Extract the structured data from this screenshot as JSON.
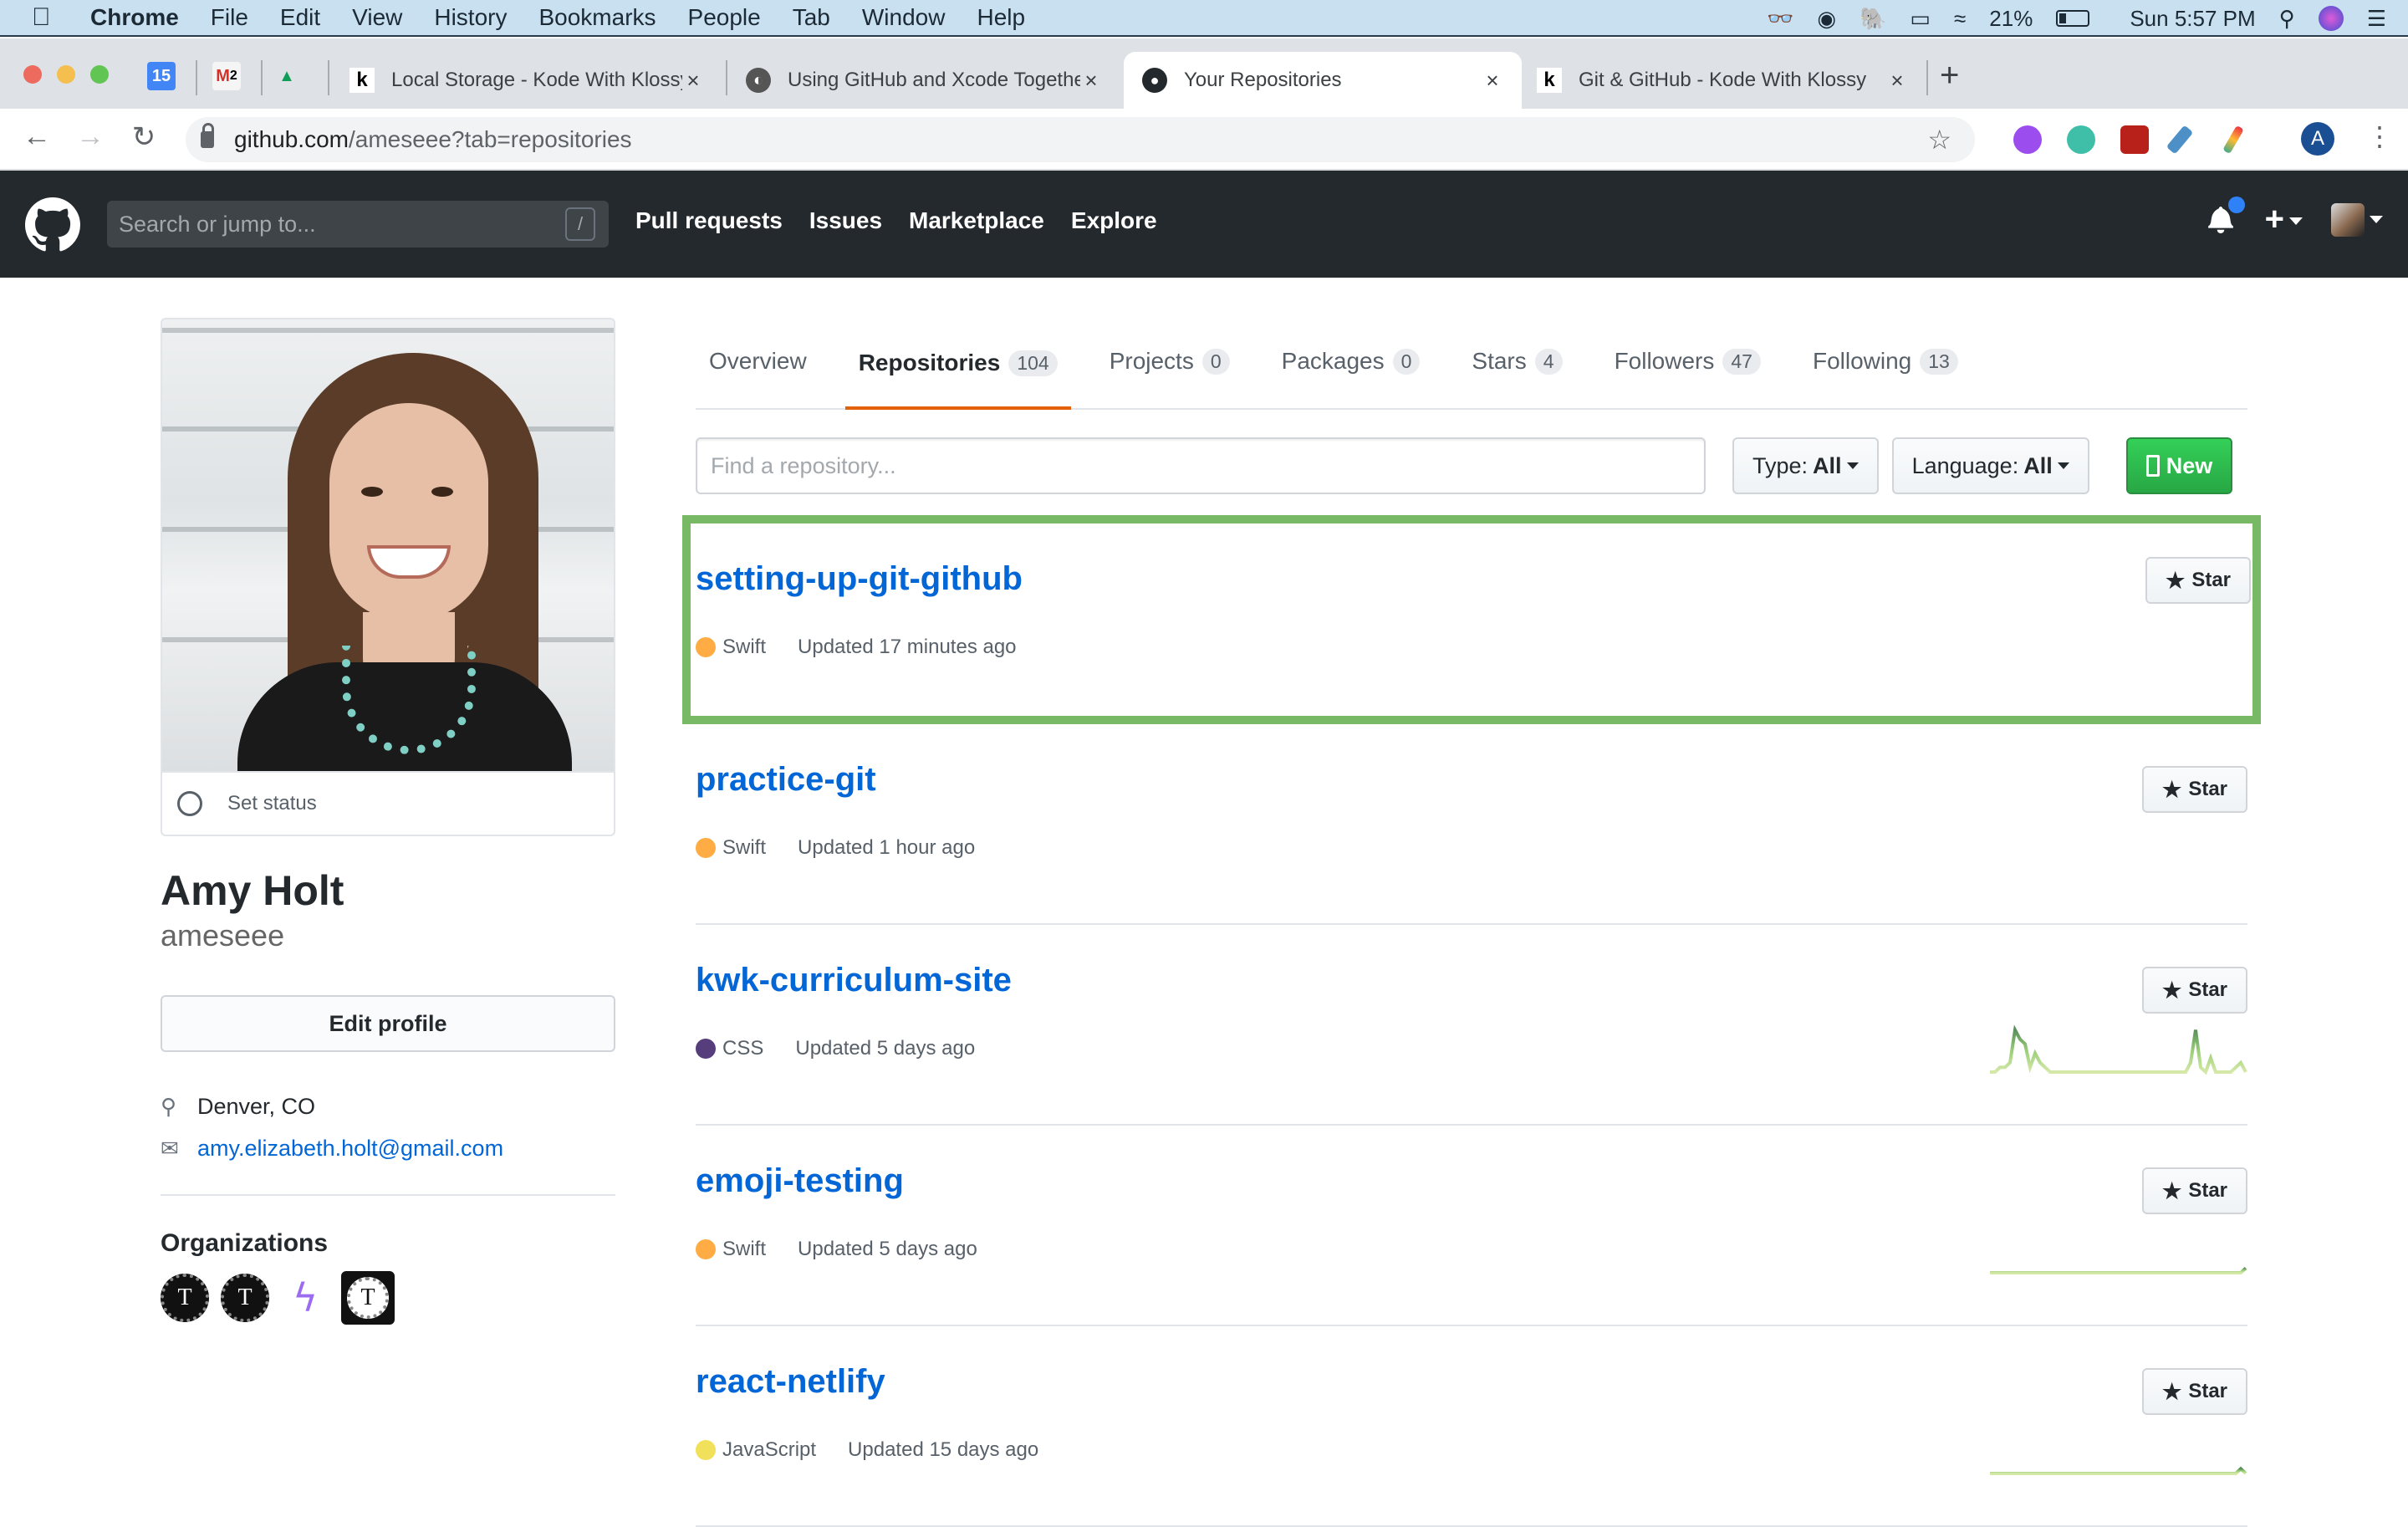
{
  "menubar": {
    "app": "Chrome",
    "items": [
      "File",
      "Edit",
      "View",
      "History",
      "Bookmarks",
      "People",
      "Tab",
      "Window",
      "Help"
    ],
    "battery": "21%",
    "clock": "Sun 5:57 PM"
  },
  "browser": {
    "pinned": [
      {
        "label": "15",
        "icon": "google-calendar-icon"
      },
      {
        "label": "M",
        "icon": "gmail-icon",
        "badge": "2"
      },
      {
        "label": "▲",
        "icon": "google-drive-icon"
      }
    ],
    "tabs": [
      {
        "title": "Local Storage - Kode With Klossy",
        "icon": "kode-with-klossy-icon"
      },
      {
        "title": "Using GitHub and Xcode Together",
        "icon": "globe-icon"
      },
      {
        "title": "Your Repositories",
        "icon": "github-icon",
        "active": true
      },
      {
        "title": "Git & GitHub - Kode With Klossy",
        "icon": "kode-with-klossy-icon"
      }
    ],
    "url_host": "github.com",
    "url_path": "/ameseee?tab=repositories",
    "profile_initial": "A"
  },
  "gh": {
    "search_placeholder": "Search or jump to...",
    "slash": "/",
    "nav": [
      "Pull requests",
      "Issues",
      "Marketplace",
      "Explore"
    ]
  },
  "profile": {
    "set_status": "Set status",
    "name": "Amy Holt",
    "username": "ameseee",
    "edit_profile": "Edit profile",
    "location": "Denver, CO",
    "email": "amy.elizabeth.holt@gmail.com",
    "organizations_title": "Organizations",
    "orgs": [
      "T",
      "T",
      "ϟ",
      "T"
    ]
  },
  "tabs": [
    {
      "label": "Overview"
    },
    {
      "label": "Repositories",
      "count": "104",
      "active": true
    },
    {
      "label": "Projects",
      "count": "0"
    },
    {
      "label": "Packages",
      "count": "0"
    },
    {
      "label": "Stars",
      "count": "4"
    },
    {
      "label": "Followers",
      "count": "47"
    },
    {
      "label": "Following",
      "count": "13"
    }
  ],
  "filters": {
    "find_placeholder": "Find a repository...",
    "type_label": "Type:",
    "type_value": "All",
    "language_label": "Language:",
    "language_value": "All",
    "new_label": "New"
  },
  "repos": [
    {
      "name": "setting-up-git-github",
      "language": "Swift",
      "lang_color": "#ffac45",
      "updated": "Updated 17 minutes ago",
      "star": "Star",
      "highlight": true,
      "activity": [
        0,
        0,
        0,
        0,
        0,
        0,
        0,
        0,
        0,
        0,
        0,
        0,
        0,
        0,
        0,
        0,
        0,
        0,
        0,
        0,
        0,
        0,
        0,
        0,
        0,
        0,
        0,
        0,
        0,
        0,
        0,
        0,
        0,
        0,
        0,
        0,
        0,
        0,
        0,
        0,
        0,
        0,
        0,
        0,
        0,
        0,
        0,
        0,
        0,
        0,
        0,
        0
      ]
    },
    {
      "name": "practice-git",
      "language": "Swift",
      "lang_color": "#ffac45",
      "updated": "Updated 1 hour ago",
      "star": "Star",
      "activity": [
        0,
        0,
        0,
        0,
        0,
        0,
        0,
        0,
        0,
        0,
        0,
        0,
        0,
        0,
        0,
        0,
        0,
        0,
        0,
        0,
        0,
        0,
        0,
        0,
        0,
        0,
        0,
        0,
        0,
        0,
        0,
        0,
        0,
        0,
        0,
        0,
        0,
        0,
        0,
        0,
        0,
        0,
        0,
        0,
        0,
        0,
        0,
        0,
        0,
        0,
        0,
        0
      ]
    },
    {
      "name": "kwk-curriculum-site",
      "language": "CSS",
      "lang_color": "#563d7c",
      "updated": "Updated 5 days ago",
      "star": "Star",
      "activity": [
        0,
        0,
        1,
        1,
        2,
        9,
        7,
        6,
        1,
        4,
        2,
        1,
        0,
        0,
        0,
        0,
        0,
        0,
        0,
        0,
        0,
        0,
        0,
        0,
        0,
        0,
        0,
        0,
        0,
        0,
        0,
        0,
        0,
        0,
        0,
        0,
        0,
        0,
        0,
        0,
        2,
        9,
        1,
        0,
        3,
        0,
        0,
        0,
        0,
        1,
        2,
        0
      ]
    },
    {
      "name": "emoji-testing",
      "language": "Swift",
      "lang_color": "#ffac45",
      "updated": "Updated 5 days ago",
      "star": "Star",
      "activity": [
        0,
        0,
        0,
        0,
        0,
        0,
        0,
        0,
        0,
        0,
        0,
        0,
        0,
        0,
        0,
        0,
        0,
        0,
        0,
        0,
        0,
        0,
        0,
        0,
        0,
        0,
        0,
        0,
        0,
        0,
        0,
        0,
        0,
        0,
        0,
        0,
        0,
        0,
        0,
        0,
        0,
        0,
        0,
        0,
        0,
        0,
        0,
        0,
        0,
        0,
        0,
        1
      ]
    },
    {
      "name": "react-netlify",
      "language": "JavaScript",
      "lang_color": "#f1e05a",
      "updated": "Updated 15 days ago",
      "star": "Star",
      "activity": [
        0,
        0,
        0,
        0,
        0,
        0,
        0,
        0,
        0,
        0,
        0,
        0,
        0,
        0,
        0,
        0,
        0,
        0,
        0,
        0,
        0,
        0,
        0,
        0,
        0,
        0,
        0,
        0,
        0,
        0,
        0,
        0,
        0,
        0,
        0,
        0,
        0,
        0,
        0,
        0,
        0,
        0,
        0,
        0,
        0,
        0,
        0,
        0,
        0,
        0,
        1,
        0
      ]
    }
  ]
}
